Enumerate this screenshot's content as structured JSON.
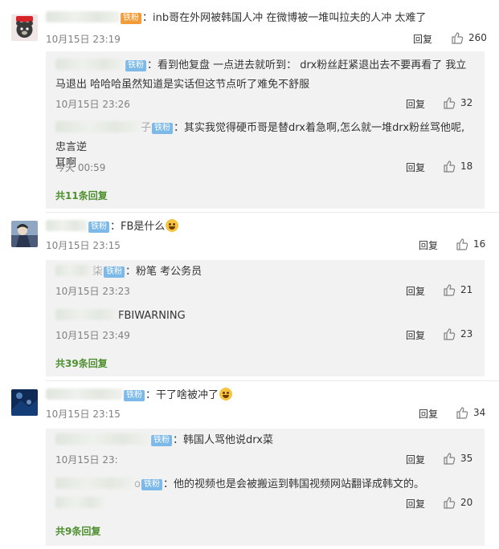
{
  "ui": {
    "reply_label": "回复",
    "badge_label": "铁粉"
  },
  "colors": {
    "more_link": "#4e8f2f",
    "badge": "#7cb9e8",
    "sub_bg": "#f2f2f2"
  },
  "comments": [
    {
      "text": "：inb哥在外网被韩国人冲 在微博被一堆叫拉夫的人冲 太难了",
      "time": "10月15日 23:19",
      "likes": "260",
      "replies": [
        {
          "text_line1": "：看到他复盘  一点进去就听到：  drx粉丝赶紧退出去不要再看了    我立",
          "text_line2": "马退出  哈哈哈虽然知道是实话但这节点听了难免不舒服",
          "time": "10月15日 23:26",
          "likes": "32"
        },
        {
          "name_tail": "子",
          "text_line1": "：其实我觉得硬币哥是替drx着急啊,怎么就一堆drx粉丝骂他呢,忠言逆",
          "text_line2": "耳啊",
          "time": "今天 00:59",
          "likes": "18"
        }
      ],
      "more": "共11条回复"
    },
    {
      "text": "：FB是什么",
      "emoji": "thinking-emoji",
      "time": "10月15日 23:15",
      "likes": "16",
      "replies": [
        {
          "name_tail": "柒",
          "text": "：粉笔 考公务员",
          "time": "10月15日 23:23",
          "likes": "21"
        },
        {
          "text": "FBIWARNING",
          "time": "10月15日 23:49",
          "likes": "23"
        }
      ],
      "more": "共39条回复"
    },
    {
      "text": "：干了啥被冲了",
      "emoji": "laughing-emoji",
      "time": "10月15日 23:15",
      "likes": "34",
      "replies": [
        {
          "text": "：韩国人骂他说drx菜",
          "time": "10月15日 23:",
          "likes": "35"
        },
        {
          "name_tail": "o",
          "text": "：他的视频也是会被搬运到韩国视频网站翻译成韩文的。",
          "time": "",
          "likes": "20"
        }
      ],
      "more": "共9条回复"
    }
  ]
}
